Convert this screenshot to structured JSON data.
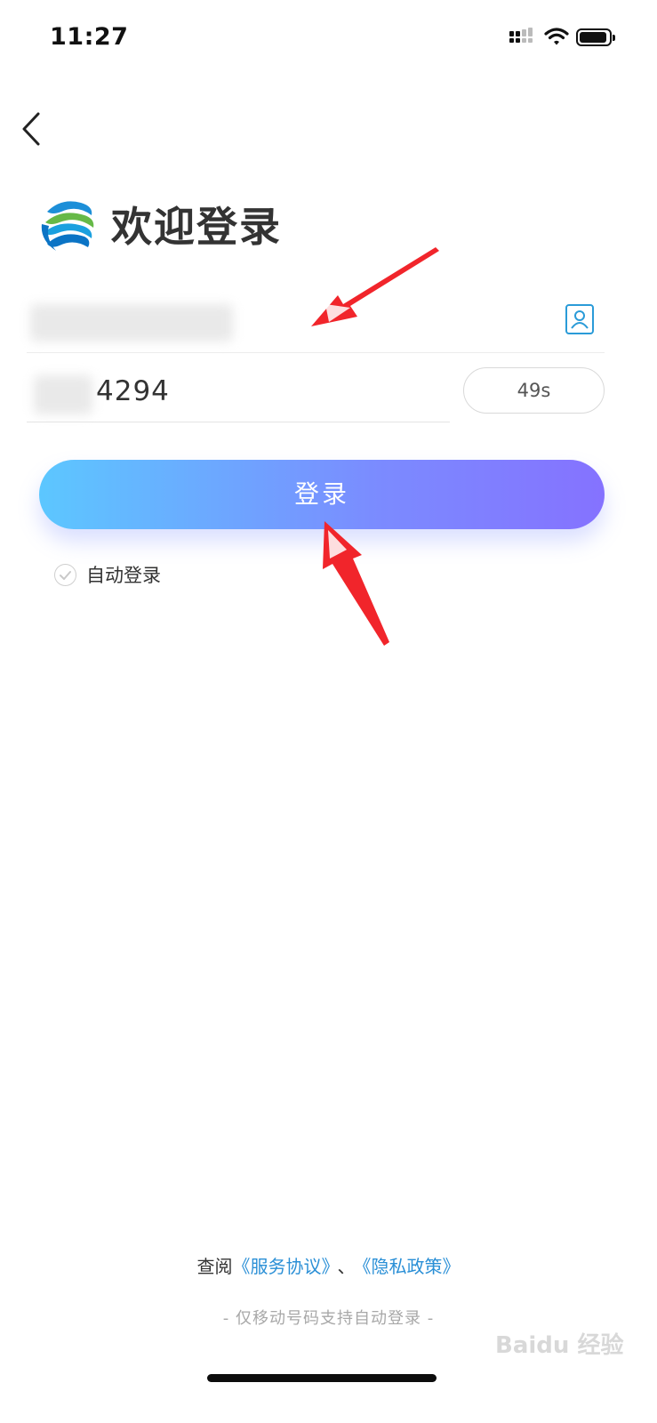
{
  "status_bar": {
    "time": "11:27"
  },
  "header": {
    "back_icon": "chevron-left-icon"
  },
  "brand": {
    "logo_icon": "china-mobile-logo",
    "title": "欢迎登录"
  },
  "phone_input": {
    "value_obscured": true,
    "contact_icon": "contact-book-icon"
  },
  "code_input": {
    "value": "4294",
    "countdown_label": "49s"
  },
  "login_button": {
    "label": "登录",
    "gradient_start": "#5cc7ff",
    "gradient_end": "#8572ff"
  },
  "auto_login": {
    "label": "自动登录",
    "checked": false
  },
  "footer": {
    "terms_prefix": "查阅",
    "service_link": "《服务协议》",
    "separator": "、",
    "privacy_link": "《隐私政策》",
    "note": "- 仅移动号码支持自动登录 -"
  },
  "colors": {
    "link": "#2a8fd6",
    "annotation_arrow": "#f1252b"
  },
  "watermark": {
    "text": "Baidu 经验"
  }
}
